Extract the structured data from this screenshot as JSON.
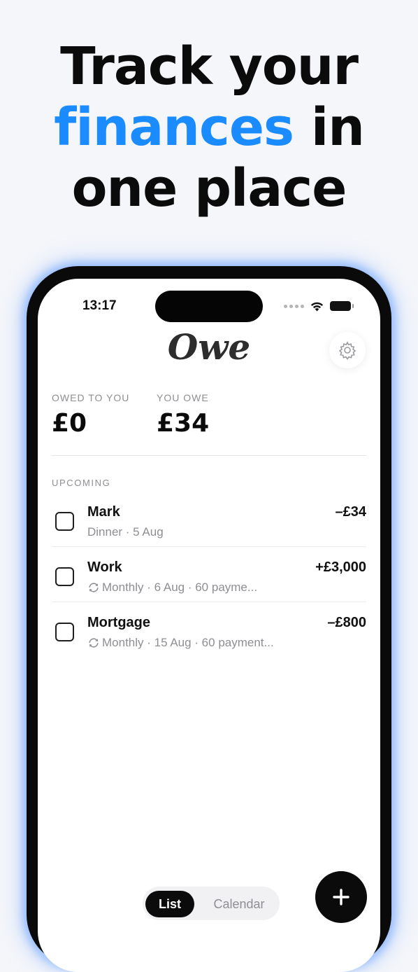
{
  "headline": {
    "line1": "Track your",
    "accent": "finances",
    "line2_rest": " in",
    "line3": "one place",
    "accent_color": "#1a8cff"
  },
  "status_bar": {
    "time": "13:17"
  },
  "app": {
    "logo": "Owe",
    "settings_icon": "gear-icon"
  },
  "summary": {
    "owed_to_you_label": "OWED TO YOU",
    "owed_to_you_value": "£0",
    "you_owe_label": "YOU OWE",
    "you_owe_value": "£34"
  },
  "upcoming": {
    "label": "UPCOMING",
    "items": [
      {
        "title": "Mark",
        "subtitle": "Dinner · 5 Aug",
        "recurring": false,
        "amount": "–£34",
        "checked": false
      },
      {
        "title": "Work",
        "subtitle": "Monthly · 6 Aug · 60 payme...",
        "recurring": true,
        "amount": "+£3,000",
        "checked": false
      },
      {
        "title": "Mortgage",
        "subtitle": "Monthly · 15 Aug · 60 payment...",
        "recurring": true,
        "amount": "–£800",
        "checked": false
      }
    ]
  },
  "view_toggle": {
    "options": [
      "List",
      "Calendar"
    ],
    "selected": "List"
  },
  "fab": {
    "icon": "plus-icon"
  }
}
